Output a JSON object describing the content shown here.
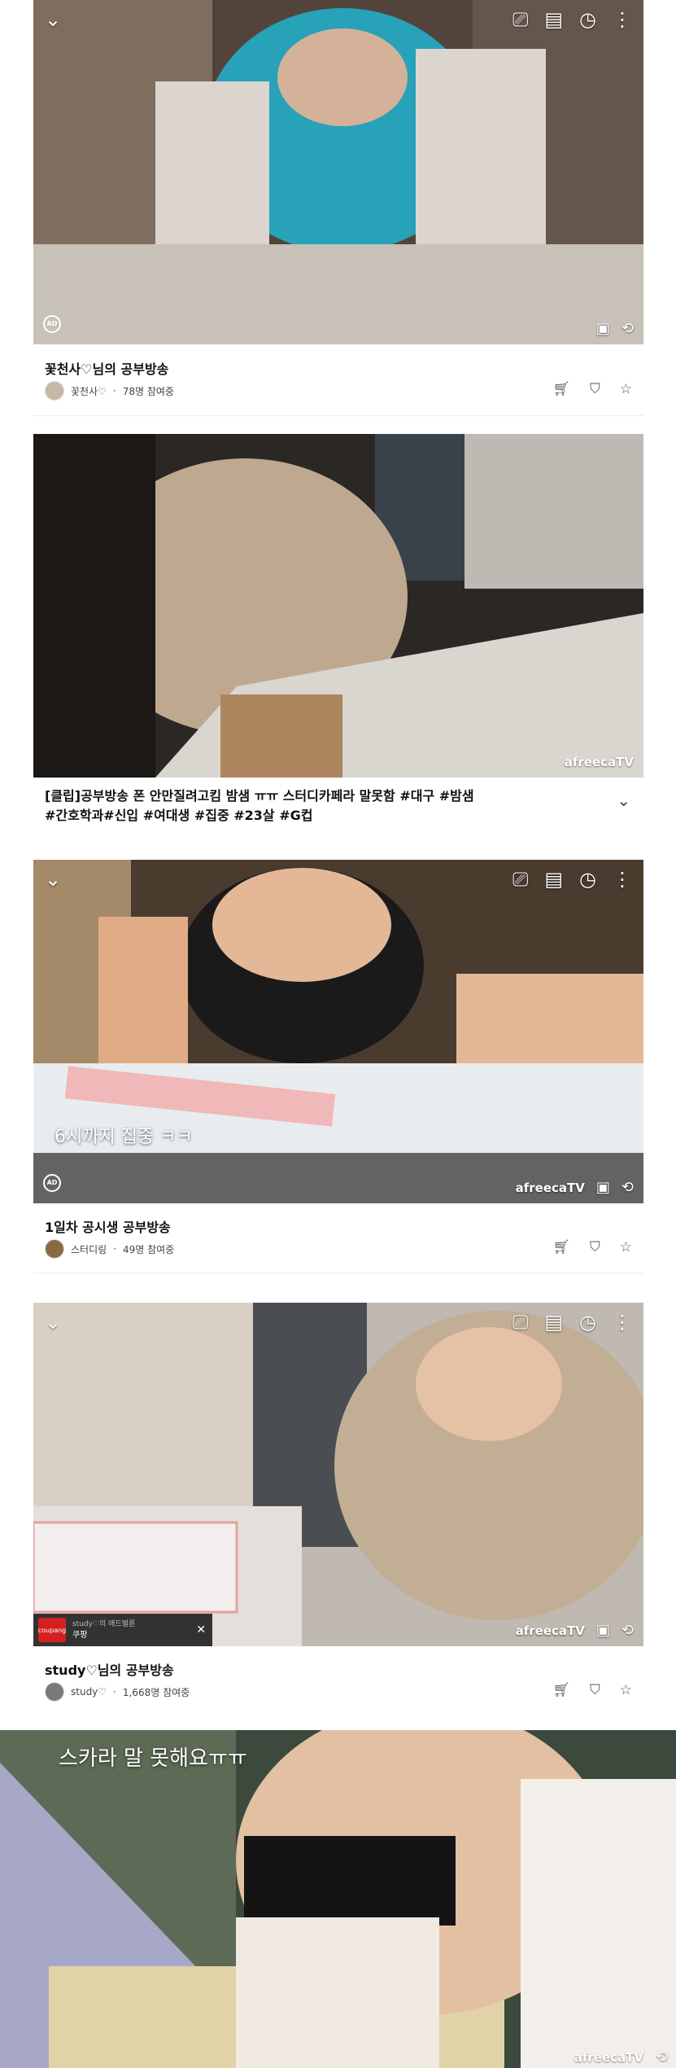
{
  "controls": {
    "collapse_icon": "chevron-down-icon",
    "cast_icon": "cast-icon",
    "clip_icon": "clapperboard-icon",
    "timer_icon": "timer-icon",
    "more_icon": "more-icon"
  },
  "logo": "afreecaTV",
  "streams": [
    {
      "title": "꽃천사♡님의 공부방송",
      "channel": "꽃천사♡",
      "viewers": "78명 참여중"
    },
    {
      "title": "1일차 공시생 공부방송",
      "channel": "스터디링",
      "viewers": "49명 참여중",
      "caption": "6시까지 집중 ㅋㅋ"
    },
    {
      "title": "study♡님의 공부방송",
      "channel": "study♡",
      "viewers": "1,668명 참여중",
      "ad": {
        "brand": "coupang",
        "line1": "study♡의 애드벌룬",
        "line2": "쿠팡",
        "close": "✕"
      }
    }
  ],
  "clip": {
    "title_line1": "[클립]공부방송 폰 안만질려고킴 밤샘 ㅠㅠ 스터디카페라 말못함 #대구 #밤샘",
    "title_line2": "#간호학과#신입 #여대생 #집중 #23살 #G컵"
  },
  "bottom": {
    "caption": "스카라 말 못해요ㅠㅠ",
    "logo": "afreecaTV"
  },
  "colors": {
    "accent": "#0a6ed1",
    "separator": "#ececec"
  }
}
